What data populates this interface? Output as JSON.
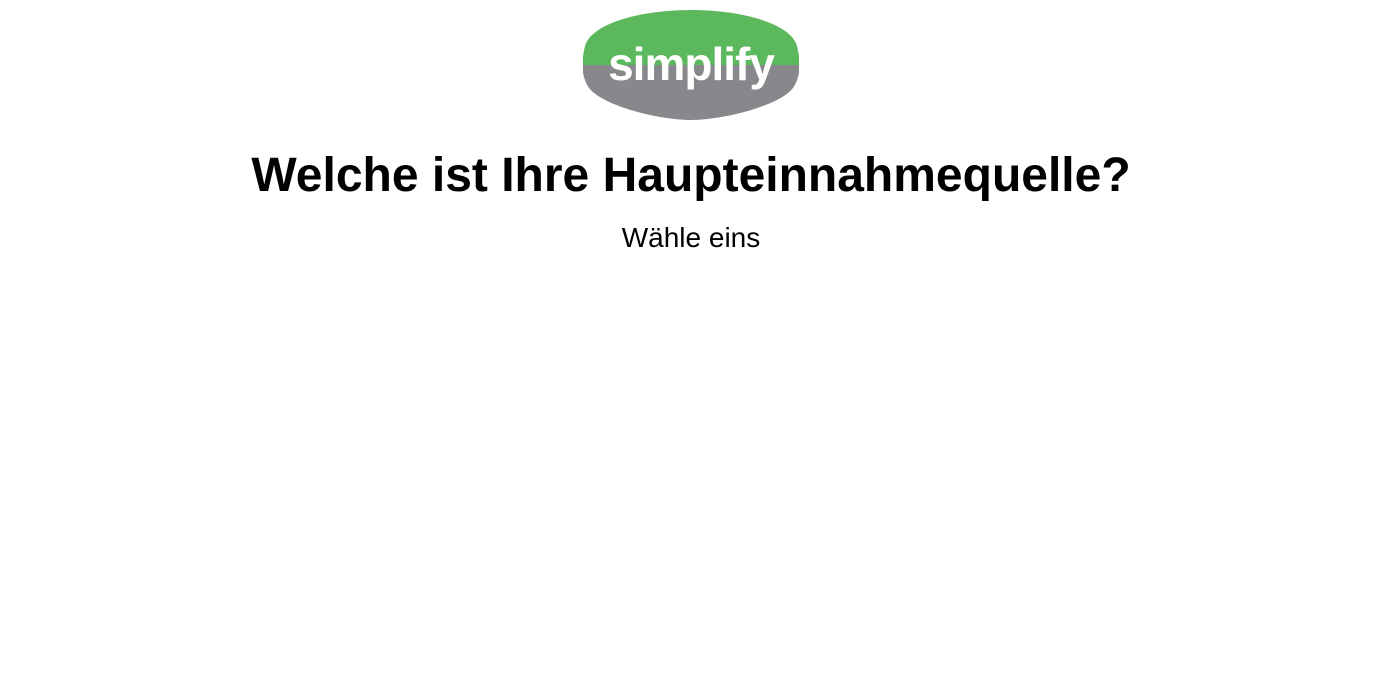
{
  "logo": {
    "text": "simplify",
    "colors": {
      "top": "#5cb85c",
      "bottom": "#87888b",
      "text": "#ffffff"
    }
  },
  "question": {
    "title": "Welche ist Ihre Haupteinnahmequelle?",
    "subtitle": "Wähle eins"
  }
}
